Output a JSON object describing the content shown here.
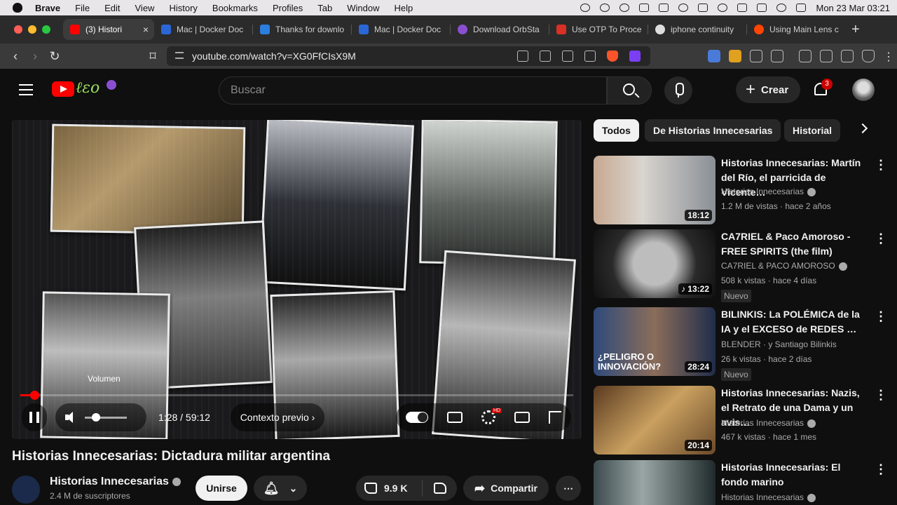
{
  "menubar": {
    "app": "Brave",
    "items": [
      "File",
      "Edit",
      "View",
      "History",
      "Bookmarks",
      "Profiles",
      "Tab",
      "Window",
      "Help"
    ],
    "clock": "Mon 23 Mar  03:21"
  },
  "tabs": [
    {
      "label": "(3) Histori",
      "color": "#ff0000"
    },
    {
      "label": "Mac | Docker Doc",
      "color": "#2b66d6"
    },
    {
      "label": "Thanks for downlo",
      "color": "#2a7ee0"
    },
    {
      "label": "Mac | Docker Doc",
      "color": "#2b66d6"
    },
    {
      "label": "Download OrbSta",
      "color": "#8a4fd1"
    },
    {
      "label": "Use OTP To Proce",
      "color": "#d93025"
    },
    {
      "label": "iphone continuity",
      "color": "#dddddd"
    },
    {
      "label": "Using Main Lens c",
      "color": "#ff4500"
    }
  ],
  "address": {
    "url": "youtube.com/watch?v=XG0FfCIsX9M",
    "brave_badge": "1"
  },
  "header": {
    "search_placeholder": "Buscar",
    "create_label": "Crear",
    "notif_count": "3"
  },
  "player": {
    "volume_tooltip": "Volumen",
    "time": "1:28 / 59:12",
    "chapter": "Contexto previo",
    "progress": 0.025,
    "hd_badge": "HD"
  },
  "video": {
    "title": "Historias Innecesarias: Dictadura militar argentina",
    "channel": "Historias Innecesarias",
    "subs": "2.4 M de suscriptores",
    "join_label": "Unirse",
    "likes": "9.9 K",
    "share_label": "Compartir"
  },
  "chips": [
    "Todos",
    "De Historias Innecesarias",
    "Historial"
  ],
  "recs": [
    {
      "title": "Historias Innecesarias: Martín del Río, el parricida de Vicente…",
      "channel": "Historias Innecesarias",
      "meta": "1.2 M de vistas · hace 2 años",
      "duration": "18:12",
      "badge": ""
    },
    {
      "title": "CA7RIEL & Paco Amoroso - FREE SPIRITS (the film)",
      "channel": "CA7RIEL & PACO AMOROSO",
      "meta": "508 k vistas · hace 4 días",
      "duration": "♪ 13:22",
      "badge": "Nuevo"
    },
    {
      "title": "BILINKIS: La POLÉMICA de la IA y el EXCESO de REDES …",
      "channel": "BLENDER · y Santiago Bilinkis",
      "meta": "26 k vistas · hace 2 días",
      "duration": "28:24",
      "badge": "Nuevo",
      "thumb_text": "¿PELIGRO O INNOVACIÓN?"
    },
    {
      "title": "Historias Innecesarias: Nazis, el Retrato de una Dama y un avis…",
      "channel": "Historias Innecesarias",
      "meta": "467 k vistas · hace 1 mes",
      "duration": "20:14",
      "badge": ""
    },
    {
      "title": "Historias Innecesarias: El fondo marino",
      "channel": "Historias Innecesarias",
      "meta": "",
      "duration": "",
      "badge": ""
    }
  ]
}
